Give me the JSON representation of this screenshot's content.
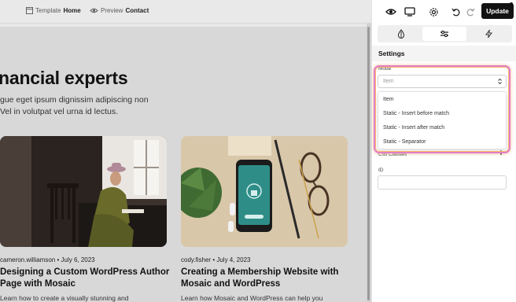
{
  "canvas_toolbar": {
    "template_prefix": "Template",
    "template_name": "Home",
    "preview_prefix": "Preview",
    "preview_name": "Contact"
  },
  "page": {
    "hero_title": "nancial experts",
    "hero_line1": "gue eget ipsum dignissim adipiscing non",
    "hero_line2": "Vel in volutpat vel urna id lectus.",
    "posts": [
      {
        "meta": "cameron.williamson • July 6, 2023",
        "title_line1": "Designing a Custom WordPress Author",
        "title_line2": "Page with Mosaic",
        "excerpt": "Learn how to create a visually stunning and"
      },
      {
        "meta": "cody.fisher • July 4, 2023",
        "title_line1": "Creating a Membership Website with",
        "title_line2": "Mosaic and WordPress",
        "excerpt": "Learn how Mosaic and WordPress can help you"
      }
    ]
  },
  "panel": {
    "update_label": "Update",
    "section_title": "Settings",
    "mode_label": "Mode",
    "mode_value": "Item",
    "mode_options": [
      "Item",
      "Static - Insert before match",
      "Static - Insert after match",
      "Static - Separator"
    ],
    "css_label": "Css Classes",
    "css_add": "+",
    "id_label": "ID",
    "id_value": ""
  },
  "icons": {
    "eye": "eye-icon",
    "desktop": "desktop-icon",
    "settings": "gear-icon",
    "undo": "undo-icon",
    "redo": "redo-icon",
    "style_tab": "drop-icon",
    "settings_tab": "sliders-icon",
    "actions_tab": "lightning-icon"
  },
  "colors": {
    "highlight": "#e27ec5",
    "highlight_glow": "#f8a76c",
    "update_bg": "#121212"
  }
}
